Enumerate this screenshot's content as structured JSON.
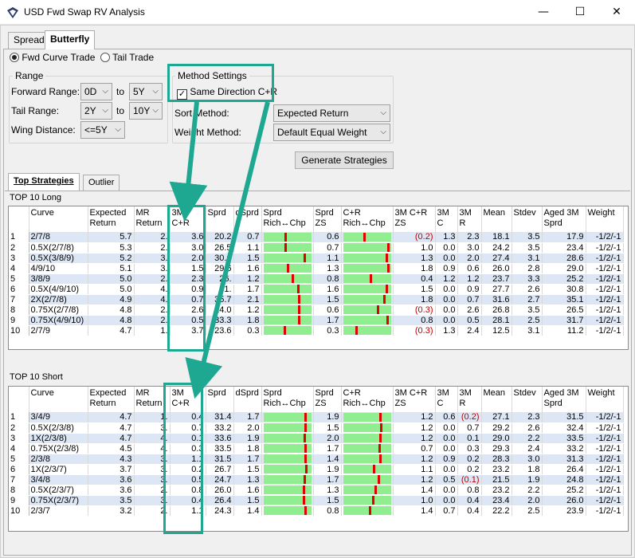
{
  "window": {
    "title": "USD Fwd Swap RV Analysis",
    "minimize": "—",
    "maximize": "☐",
    "close": "✕"
  },
  "tabs": [
    "Spread",
    "Butterfly"
  ],
  "mode": {
    "fwd": "Fwd Curve Trade",
    "tail": "Tail Trade"
  },
  "range": {
    "title": "Range",
    "forward_label": "Forward Range:",
    "forward_from": "0D",
    "forward_to": "5Y",
    "to": "to",
    "tail_label": "Tail Range:",
    "tail_from": "2Y",
    "tail_to": "10Y",
    "wing_label": "Wing Distance:",
    "wing_value": "<=5Y"
  },
  "method": {
    "title": "Method Settings",
    "same_direction": "Same Direction C+R",
    "sort_label": "Sort Method:",
    "sort_value": "Expected Return",
    "weight_label": "Weight Method:",
    "weight_value": "Default Equal Weight"
  },
  "generate": "Generate Strategies",
  "subtabs": [
    "Top Strategies",
    "Outlier"
  ],
  "long_title": "TOP 10 Long",
  "short_title": "TOP 10 Short",
  "columns": [
    "",
    "Curve",
    "Expected Return",
    "MR Return",
    "3M C+R",
    "Sprd",
    "dSprd",
    "Sprd Rich↔Chp",
    "Sprd ZS",
    "C+R Rich↔Chp",
    "3M C+R ZS",
    "3M C",
    "3M R",
    "Mean",
    "Stdev",
    "Aged 3M Sprd",
    "Weight"
  ],
  "long_rows": [
    [
      "1",
      "2/7/8",
      "5.7",
      "2.",
      "3.6",
      "20.2",
      "0.7",
      0.47,
      "0.6",
      0.45,
      "(0.2)",
      "1.3",
      "2.3",
      "18.1",
      "3.5",
      "17.9",
      "-1/2/-1"
    ],
    [
      "2",
      "0.5X(2/7/8)",
      "5.3",
      "2.",
      "3.0",
      "26.5",
      "1.1",
      0.47,
      "0.7",
      0.97,
      "1.0",
      "0.0",
      "3.0",
      "24.2",
      "3.5",
      "23.4",
      "-1/2/-1"
    ],
    [
      "3",
      "0.5X(3/8/9)",
      "5.2",
      "3.",
      "2.0",
      "30.6",
      "1.5",
      0.88,
      "1.1",
      0.93,
      "1.3",
      "0.0",
      "2.0",
      "27.4",
      "3.1",
      "28.6",
      "-1/2/-1"
    ],
    [
      "4",
      "4/9/10",
      "5.1",
      "3.",
      "1.5",
      "29.6",
      "1.6",
      0.52,
      "1.3",
      0.98,
      "1.8",
      "0.9",
      "0.6",
      "26.0",
      "2.8",
      "29.0",
      "-1/2/-1"
    ],
    [
      "5",
      "3/8/9",
      "5.0",
      "2.",
      "2.3",
      "26.",
      "1.2",
      0.62,
      "0.8",
      0.58,
      "0.4",
      "1.2",
      "1.2",
      "23.7",
      "3.3",
      "25.2",
      "-1/2/-1"
    ],
    [
      "6",
      "0.5X(4/9/10)",
      "5.0",
      "4.",
      "0.9",
      "31.",
      "1.7",
      0.75,
      "1.6",
      0.93,
      "1.5",
      "0.0",
      "0.9",
      "27.7",
      "2.6",
      "30.8",
      "-1/2/-1"
    ],
    [
      "7",
      "2X(2/7/8)",
      "4.9",
      "4.",
      "0.7",
      "35.7",
      "2.1",
      0.77,
      "1.5",
      0.89,
      "1.8",
      "0.0",
      "0.7",
      "31.6",
      "2.7",
      "35.1",
      "-1/2/-1"
    ],
    [
      "8",
      "0.75X(2/7/8)",
      "4.8",
      "2.",
      "2.6",
      "24.0",
      "1.2",
      0.76,
      "0.6",
      0.75,
      "(0.3)",
      "0.0",
      "2.6",
      "26.8",
      "3.5",
      "26.5",
      "-1/2/-1"
    ],
    [
      "9",
      "0.75X(4/9/10)",
      "4.8",
      "2.",
      "0.5",
      "33.3",
      "1.8",
      0.77,
      "1.7",
      0.95,
      "0.8",
      "0.0",
      "0.5",
      "28.1",
      "2.5",
      "31.7",
      "-1/2/-1"
    ],
    [
      "10",
      "2/7/9",
      "4.7",
      "1.",
      "3.7",
      "23.6",
      "0.3",
      0.45,
      "0.3",
      0.28,
      "(0.3)",
      "1.3",
      "2.4",
      "12.5",
      "3.1",
      "11.2",
      "-1/2/-1"
    ]
  ],
  "short_rows": [
    [
      "1",
      "3/4/9",
      "4.7",
      "1.",
      "0.4",
      "31.4",
      "1.7",
      0.9,
      "1.9",
      0.8,
      "1.2",
      "0.6",
      "(0.2)",
      "27.1",
      "2.3",
      "31.5",
      "-1/2/-1"
    ],
    [
      "2",
      "0.5X(2/3/8)",
      "4.7",
      "3.",
      "0.7",
      "33.2",
      "2.0",
      0.91,
      "1.5",
      0.82,
      "1.2",
      "0.0",
      "0.7",
      "29.2",
      "2.6",
      "32.4",
      "-1/2/-1"
    ],
    [
      "3",
      "1X(2/3/8)",
      "4.7",
      "4.",
      "0.1",
      "33.6",
      "1.9",
      0.88,
      "2.0",
      0.8,
      "1.2",
      "0.0",
      "0.1",
      "29.0",
      "2.2",
      "33.5",
      "-1/2/-1"
    ],
    [
      "4",
      "0.75X(2/3/8)",
      "4.5",
      "4.",
      "0.3",
      "33.5",
      "1.8",
      0.9,
      "1.7",
      0.78,
      "0.7",
      "0.0",
      "0.3",
      "29.3",
      "2.4",
      "33.2",
      "-1/2/-1"
    ],
    [
      "5",
      "2/3/8",
      "4.3",
      "3.",
      "1.1",
      "31.5",
      "1.7",
      0.9,
      "1.4",
      0.79,
      "1.2",
      "0.9",
      "0.2",
      "28.3",
      "3.0",
      "31.3",
      "-1/2/-1"
    ],
    [
      "6",
      "1X(2/3/7)",
      "3.7",
      "3.",
      "0.2",
      "26.7",
      "1.5",
      0.92,
      "1.9",
      0.65,
      "1.1",
      "0.0",
      "0.2",
      "23.2",
      "1.8",
      "26.4",
      "-1/2/-1"
    ],
    [
      "7",
      "3/4/8",
      "3.6",
      "3.",
      "0.5",
      "24.7",
      "1.3",
      0.88,
      "1.7",
      0.76,
      "1.2",
      "0.5",
      "(0.1)",
      "21.5",
      "1.9",
      "24.8",
      "-1/2/-1"
    ],
    [
      "8",
      "0.5X(2/3/7)",
      "3.6",
      "2.",
      "0.8",
      "26.0",
      "1.6",
      0.87,
      "1.3",
      0.69,
      "1.4",
      "0.0",
      "0.8",
      "23.2",
      "2.2",
      "25.2",
      "-1/2/-1"
    ],
    [
      "9",
      "0.75X(2/3/7)",
      "3.5",
      "3.",
      "0.4",
      "26.4",
      "1.5",
      0.87,
      "1.5",
      0.64,
      "1.0",
      "0.0",
      "0.4",
      "23.4",
      "2.0",
      "26.0",
      "-1/2/-1"
    ],
    [
      "10",
      "2/3/7",
      "3.2",
      "2.",
      "1.1",
      "24.3",
      "1.4",
      0.9,
      "0.8",
      0.57,
      "1.4",
      "0.7",
      "0.4",
      "22.2",
      "2.5",
      "23.9",
      "-1/2/-1"
    ]
  ],
  "colors": {
    "accent": "#1fa891",
    "negative": "#c00000",
    "bar": "#90ee90",
    "marker": "#e00000",
    "row_alt": "#dce6f4"
  }
}
